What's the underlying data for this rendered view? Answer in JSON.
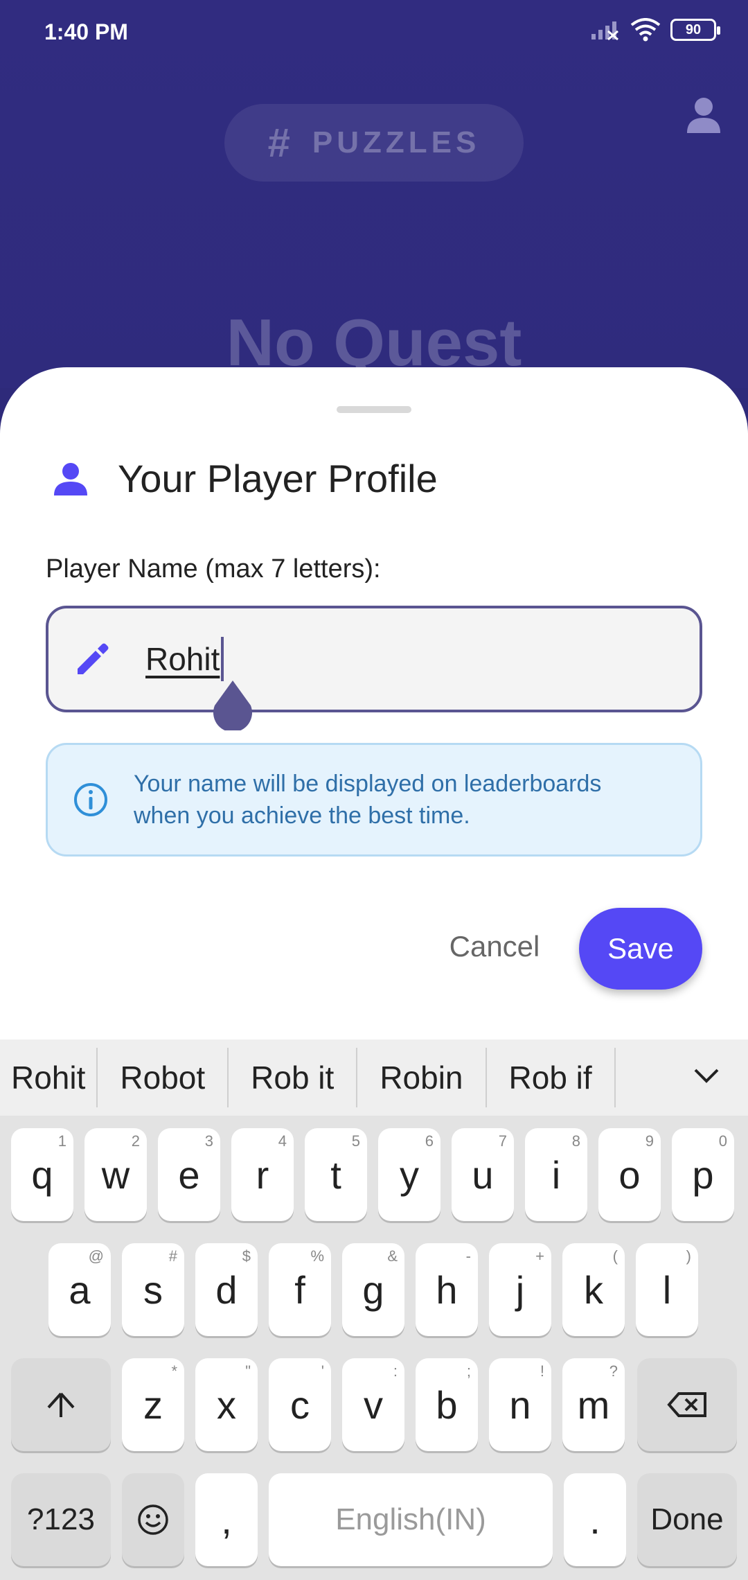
{
  "status_bar": {
    "time": "1:40 PM",
    "battery": "90"
  },
  "background_app": {
    "pill_label": "PUZZLES",
    "title": "No Quest"
  },
  "dialog": {
    "title": "Your Player Profile",
    "field_label": "Player Name (max 7 letters):",
    "name_value": "Rohit",
    "info_line1": "Your name will be displayed on leaderboards",
    "info_line2": "when you achieve the best time.",
    "cancel_label": "Cancel",
    "save_label": "Save",
    "accent_color": "#5548f5"
  },
  "keyboard": {
    "suggestions": [
      "Rohit",
      "Robot",
      "Rob it",
      "Robin",
      "Rob if"
    ],
    "row1": [
      {
        "k": "q",
        "h": "1"
      },
      {
        "k": "w",
        "h": "2"
      },
      {
        "k": "e",
        "h": "3"
      },
      {
        "k": "r",
        "h": "4"
      },
      {
        "k": "t",
        "h": "5"
      },
      {
        "k": "y",
        "h": "6"
      },
      {
        "k": "u",
        "h": "7"
      },
      {
        "k": "i",
        "h": "8"
      },
      {
        "k": "o",
        "h": "9"
      },
      {
        "k": "p",
        "h": "0"
      }
    ],
    "row2": [
      {
        "k": "a",
        "h": "@"
      },
      {
        "k": "s",
        "h": "#"
      },
      {
        "k": "d",
        "h": "$"
      },
      {
        "k": "f",
        "h": "%"
      },
      {
        "k": "g",
        "h": "&"
      },
      {
        "k": "h",
        "h": "-"
      },
      {
        "k": "j",
        "h": "+"
      },
      {
        "k": "k",
        "h": "("
      },
      {
        "k": "l",
        "h": ")"
      }
    ],
    "row3": [
      {
        "k": "z",
        "h": "*"
      },
      {
        "k": "x",
        "h": "\""
      },
      {
        "k": "c",
        "h": "'"
      },
      {
        "k": "v",
        "h": ":"
      },
      {
        "k": "b",
        "h": ";"
      },
      {
        "k": "n",
        "h": "!"
      },
      {
        "k": "m",
        "h": "?"
      }
    ],
    "symbols_label": "?123",
    "comma": ",",
    "space_label": "English(IN)",
    "period": ".",
    "done_label": "Done"
  }
}
